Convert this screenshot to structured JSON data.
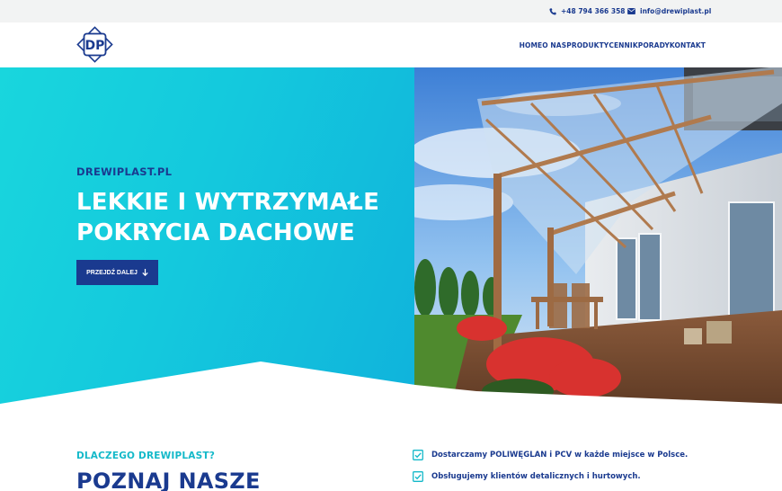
{
  "topbar": {
    "phone": "+48 794 366 358",
    "email": "info@drewiplast.pl",
    "phone_icon": "phone-icon",
    "email_icon": "envelope-icon"
  },
  "header": {
    "logo_text": "DP",
    "nav": [
      "HOME",
      "O NAS",
      "PRODUKTY",
      "CENNIK",
      "PORADY",
      "KONTAKT"
    ]
  },
  "hero": {
    "kicker": "DREWIPLAST.PL",
    "headline": "LEKKIE I WYTRZYMAŁE POKRYCIA DACHOWE",
    "cta_label": "PRZEJDŹ DALEJ",
    "cta_icon": "arrow-down-icon"
  },
  "why": {
    "kicker": "DLACZEGO DREWIPLAST?",
    "title": "POZNAJ NASZE",
    "benefits": [
      "Dostarczamy POLIWĘGLAN i PCV w każde miejsce w Polsce.",
      "Obsługujemy klientów detalicznych i hurtowych."
    ]
  },
  "colors": {
    "brand_blue": "#1a3a8f",
    "accent_teal": "#14b9c9",
    "hero_cyan": "#19d6dd"
  }
}
